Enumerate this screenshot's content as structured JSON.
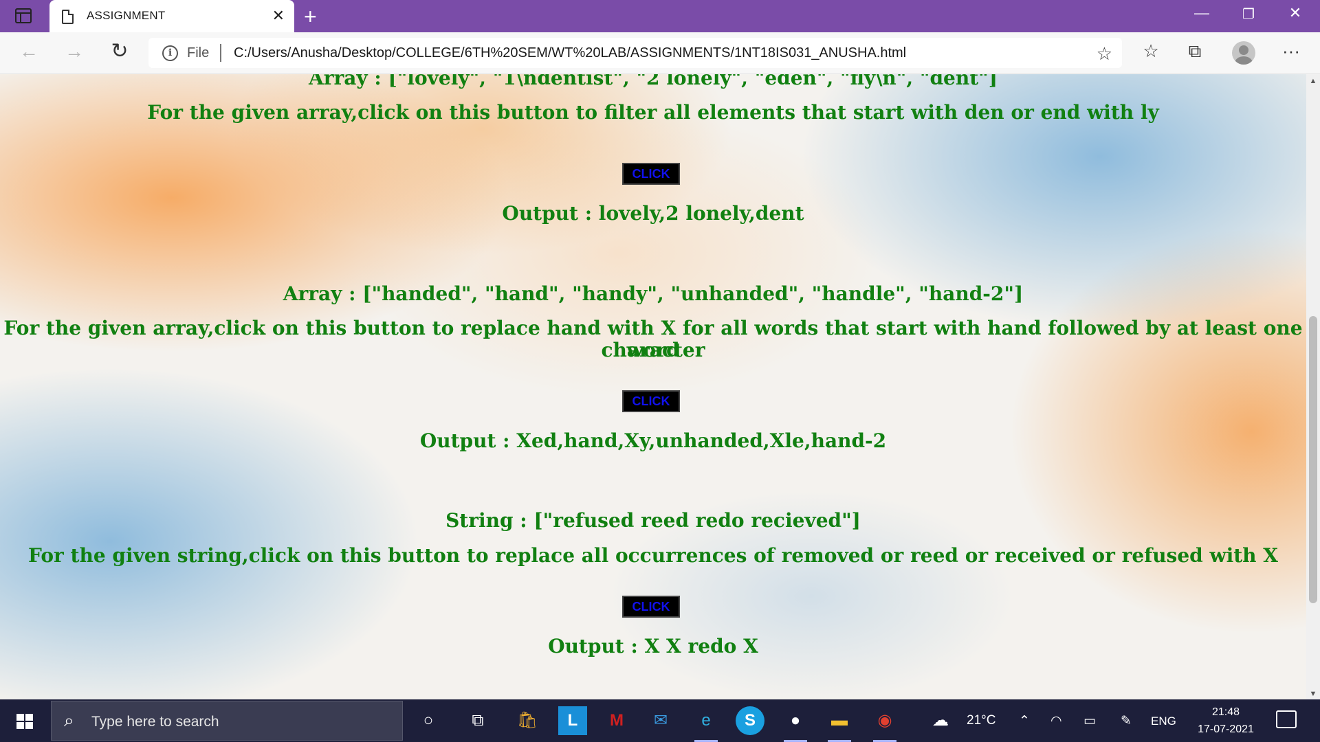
{
  "browser": {
    "tab_title": "ASSIGNMENT",
    "file_label": "File",
    "url": "C:/Users/Anusha/Desktop/COLLEGE/6TH%20SEM/WT%20LAB/ASSIGNMENTS/1NT18IS031_ANUSHA.html"
  },
  "page": {
    "sections": [
      {
        "array_text": "Array : [\"lovely\", \"1\\ndentist\", \"2 lonely\", \"eden\", \"fly\\n\", \"dent\"]",
        "instruction": "For the given array,click on this button to filter all elements that start with den or end with ly",
        "button_label": "CLICK",
        "output": "Output : lovely,2 lonely,dent"
      },
      {
        "array_text": "Array : [\"handed\", \"hand\", \"handy\", \"unhanded\", \"handle\", \"hand-2\"]",
        "instruction_line1": "For the given array,click on this button to replace hand with X for all words that start with hand followed by at least one word",
        "instruction_line2": "character",
        "button_label": "CLICK",
        "output": "Output : Xed,hand,Xy,unhanded,Xle,hand-2"
      },
      {
        "array_text": "String : [\"refused reed redo recieved\"]",
        "instruction": "For the given string,click on this button to replace all occurrences of removed or reed or received or refused with X",
        "button_label": "CLICK",
        "output": "Output : X X redo X"
      }
    ]
  },
  "taskbar": {
    "search_placeholder": "Type here to search",
    "weather": "21°C",
    "language": "ENG",
    "time": "21:48",
    "date": "17-07-2021"
  },
  "icons": [
    "window-menu-icon",
    "document-icon",
    "close-icon",
    "new-tab-icon",
    "back-icon",
    "forward-icon",
    "reload-icon",
    "info-icon",
    "add-favorite-icon",
    "favorites-icon",
    "collections-icon",
    "profile-icon",
    "more-icon",
    "windows-start-icon",
    "search-icon",
    "cortana-icon",
    "task-view-icon",
    "store-icon",
    "mcafee-icon",
    "mail-icon",
    "edge-icon",
    "skype-icon",
    "file-explorer-icon",
    "chrome-icon",
    "weather-icon",
    "wifi-icon",
    "battery-icon",
    "pen-icon",
    "notification-icon"
  ],
  "colors": {
    "titlebar": "#7a4ca8",
    "content_text": "#118011",
    "button_bg": "#000000",
    "button_text": "#1111ee",
    "taskbar": "#1d1f3a"
  }
}
